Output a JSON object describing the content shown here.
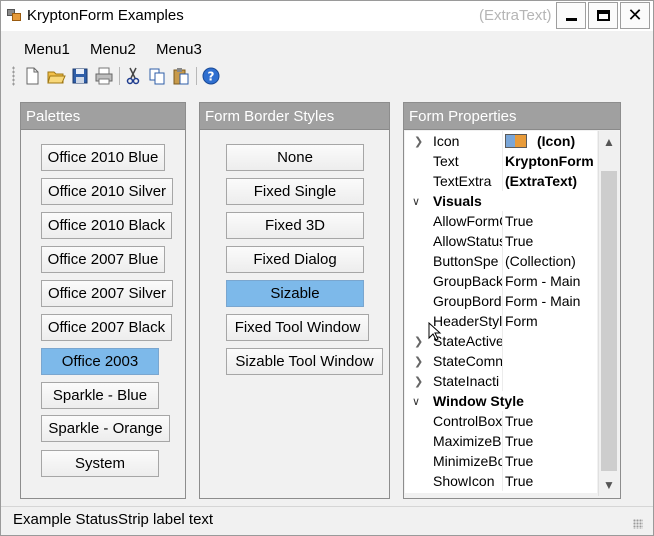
{
  "window": {
    "title": "KryptonForm Examples",
    "extra_text": "(ExtraText)",
    "controls": {
      "minimize": "minimize-icon",
      "maximize": "maximize-icon",
      "close": "✕"
    }
  },
  "menu": [
    "Menu1",
    "Menu2",
    "Menu3"
  ],
  "toolbar": [
    "new-icon",
    "open-icon",
    "save-icon",
    "print-icon",
    "cut-icon",
    "copy-icon",
    "paste-icon",
    "help-icon"
  ],
  "palettes": {
    "title": "Palettes",
    "buttons": [
      "Office 2010 Blue",
      "Office 2010 Silver",
      "Office 2010 Black",
      "Office 2007 Blue",
      "Office 2007 Silver",
      "Office 2007 Black",
      "Office 2003",
      "Sparkle - Blue",
      "Sparkle - Orange",
      "System"
    ],
    "selected": "Office 2003"
  },
  "border_styles": {
    "title": "Form Border Styles",
    "buttons": [
      "None",
      "Fixed Single",
      "Fixed 3D",
      "Fixed Dialog",
      "Sizable",
      "Fixed Tool Window",
      "Sizable Tool Window"
    ],
    "selected": "Sizable"
  },
  "properties": {
    "title": "Form Properties",
    "rows": [
      {
        "name": "Icon",
        "value": "(Icon)",
        "bold": true,
        "expander": "collapsed",
        "icon": true
      },
      {
        "name": "Text",
        "value": "KryptonForm",
        "bold": true
      },
      {
        "name": "TextExtra",
        "value": "(ExtraText)",
        "bold": true
      },
      {
        "name": "Visuals",
        "category": true
      },
      {
        "name": "AllowFormC",
        "value": "True"
      },
      {
        "name": "AllowStatus",
        "value": "True"
      },
      {
        "name": "ButtonSpe",
        "value": "(Collection)"
      },
      {
        "name": "GroupBack",
        "value": "Form - Main"
      },
      {
        "name": "GroupBord",
        "value": "Form - Main"
      },
      {
        "name": "HeaderStyl",
        "value": "Form"
      },
      {
        "name": "StateActive",
        "value": "",
        "expander": "collapsed"
      },
      {
        "name": "StateComn",
        "value": "",
        "expander": "collapsed"
      },
      {
        "name": "StateInacti",
        "value": "",
        "expander": "collapsed"
      },
      {
        "name": "Window Style",
        "category": true
      },
      {
        "name": "ControlBox",
        "value": "True"
      },
      {
        "name": "MaximizeBo",
        "value": "True"
      },
      {
        "name": "MinimizeBo",
        "value": "True"
      },
      {
        "name": "ShowIcon",
        "value": "True"
      }
    ]
  },
  "status": {
    "label": "Example StatusStrip label text"
  }
}
